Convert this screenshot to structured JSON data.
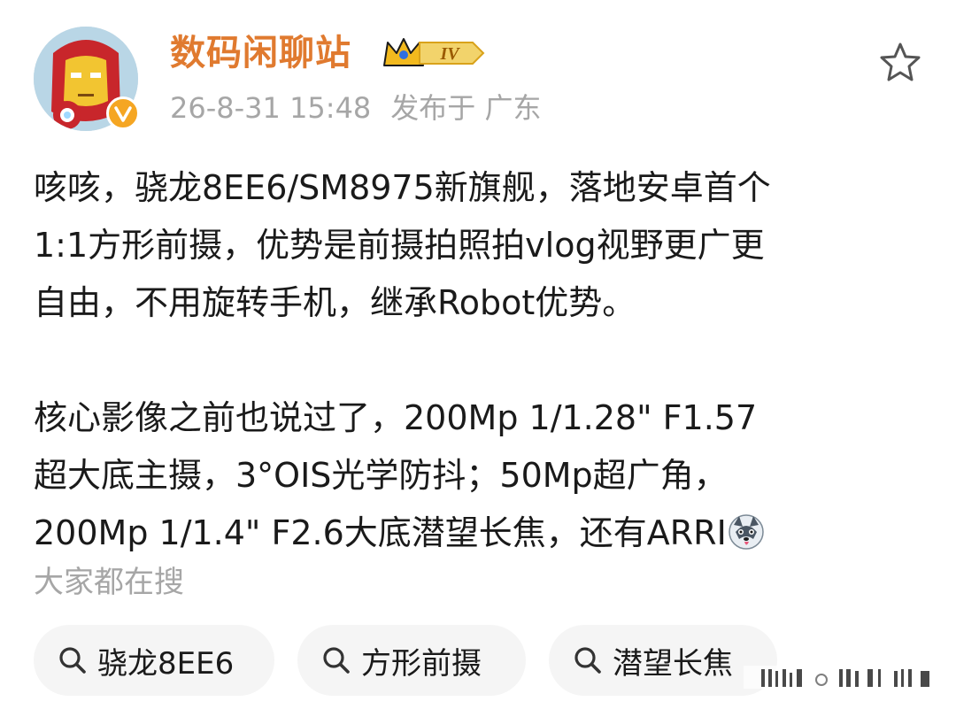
{
  "post": {
    "author": {
      "name": "数码闲聊站",
      "level_badge": "IV",
      "avatar_icon": "iron-man-avatar",
      "verified_icon": "verified-badge-icon"
    },
    "time": "26-8-31 15:48",
    "location": "发布于 广东",
    "star_icon": "star-outline-icon",
    "paragraphs": [
      {
        "lines": [
          "咳咳，骁龙8EE6/SM8975新旗舰，落地安卓首个",
          "1:1方形前摄，优势是前摄拍照拍vlog视野更广更",
          "自由，不用旋转手机，继承Robot优势。"
        ]
      },
      {
        "lines": [
          "核心影像之前也说过了，200Mp 1/1.28\" F1.57",
          "超大底主摄，3°OIS光学防抖；50Mp超广角，",
          "200Mp 1/1.4\" F2.6大底潜望长焦，还有ARRI"
        ],
        "trailing_emoji": "husky-emoji"
      }
    ]
  },
  "search": {
    "heading": "大家都在搜",
    "chips": [
      {
        "label": "骁龙8EE6",
        "icon": "search-icon"
      },
      {
        "label": "方形前摄",
        "icon": "search-icon"
      },
      {
        "label": "潜望长焦",
        "icon": "search-icon"
      }
    ]
  },
  "colors": {
    "username": "#e07a2f",
    "meta": "#a6a6a6",
    "chip_bg": "#f5f5f5",
    "badge_gold": "#f5a623"
  }
}
